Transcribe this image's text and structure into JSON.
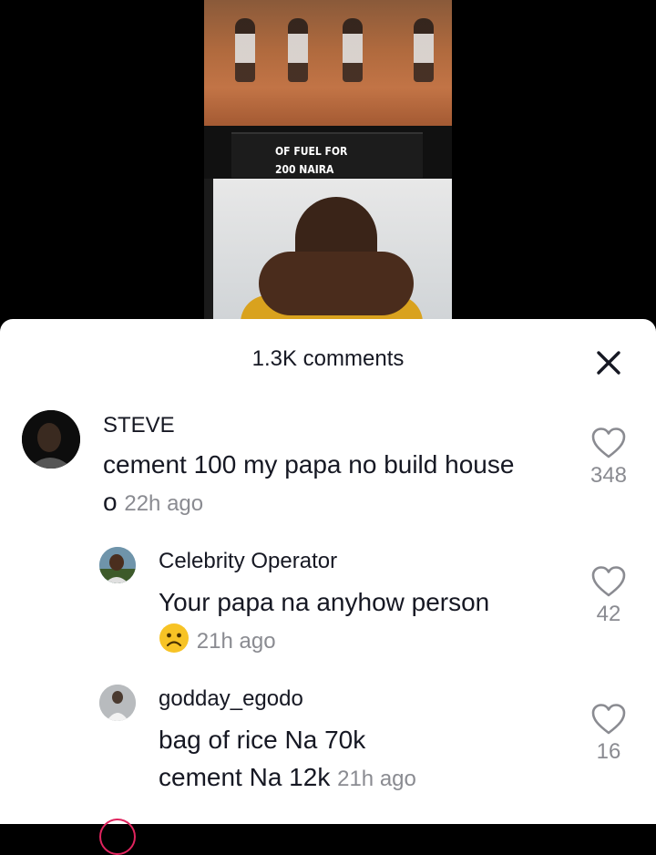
{
  "video": {
    "banner_line1": "OF FUEL FOR",
    "banner_line2": "200 NAIRA"
  },
  "sheet": {
    "title": "1.3K comments",
    "close_icon": "close-icon"
  },
  "comments": [
    {
      "username": "STEVE",
      "text": "cement 100 my papa no build house o",
      "time": "22h ago",
      "likes": "348"
    },
    {
      "username": "Celebrity Operator",
      "text": "Your papa na anyhow person",
      "emoji": "frowning-face-emoji",
      "time": "21h ago",
      "likes": "42"
    },
    {
      "username": "godday_egodo",
      "text_line1": "bag of rice Na 70k",
      "text_line2": "cement Na 12k",
      "time": "21h ago",
      "likes": "16"
    }
  ],
  "colors": {
    "text_primary": "#161823",
    "text_secondary": "#8a8b91",
    "sheet_bg": "#ffffff"
  }
}
